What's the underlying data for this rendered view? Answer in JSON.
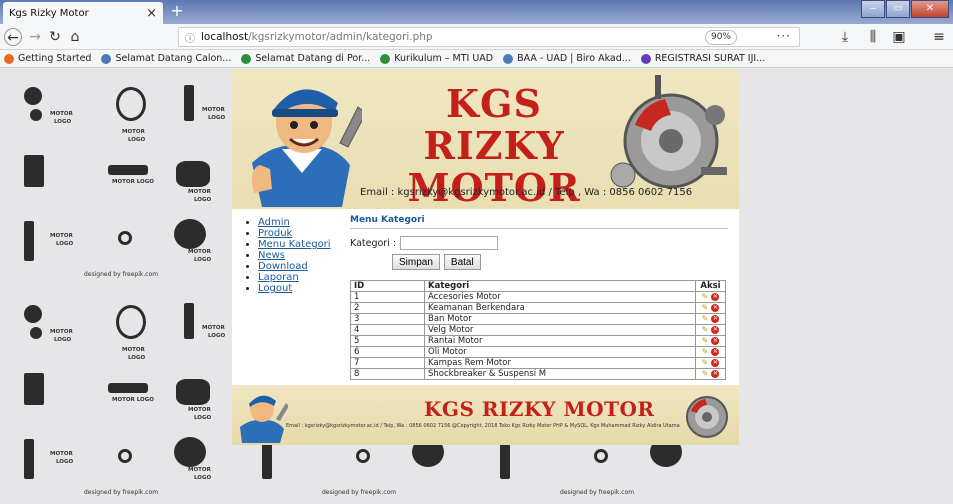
{
  "browser": {
    "tab_title": "Kgs Rizky Motor",
    "tab_close": "×",
    "new_tab": "+",
    "url_host": "localhost",
    "url_path": "/kgsrizkymotor/admin/kategori.php",
    "zoom": "90%",
    "more": "···",
    "bookmarks": [
      {
        "label": "Getting Started",
        "color": "#e66b1e"
      },
      {
        "label": "Selamat Datang Calon...",
        "color": "#4a7db8"
      },
      {
        "label": "Selamat Datang di Por...",
        "color": "#2c8f3a"
      },
      {
        "label": "Kurikulum – MTI UAD",
        "color": "#2c8f3a"
      },
      {
        "label": "BAA - UAD | Biro Akad...",
        "color": "#4a7db8"
      },
      {
        "label": "REGISTRASI SURAT IJI...",
        "color": "#6a3db8"
      }
    ]
  },
  "header": {
    "title_line1": "KGS RIZKY",
    "title_line2": "MOTOR",
    "contact": "Email : kgsrizky@kgsrizkymotor.ac.id / Telp , Wa : 0856 0602 7156"
  },
  "sidebar": {
    "items": [
      "Admin",
      "Produk",
      "Menu Kategori",
      "News",
      "Download",
      "Laporan",
      "Logout"
    ]
  },
  "main": {
    "section_title": "Menu Kategori",
    "field_label": "Kategori :",
    "field_value": "",
    "save_label": "Simpan",
    "cancel_label": "Batal",
    "table": {
      "headers": [
        "ID",
        "Kategori",
        "Aksi"
      ],
      "rows": [
        {
          "id": "1",
          "kategori": "Accesories Motor"
        },
        {
          "id": "2",
          "kategori": "Keamanan Berkendara"
        },
        {
          "id": "3",
          "kategori": "Ban Motor"
        },
        {
          "id": "4",
          "kategori": "Velg Motor"
        },
        {
          "id": "5",
          "kategori": "Rantai Motor"
        },
        {
          "id": "6",
          "kategori": "Oli Motor"
        },
        {
          "id": "7",
          "kategori": "Kampas Rem Motor"
        },
        {
          "id": "8",
          "kategori": "Shockbreaker & Suspensi M"
        }
      ]
    }
  },
  "footer": {
    "title": "KGS RIZKY MOTOR",
    "text": "Email : kgsrizky@kgsrizkymotor.ac.id / Telp, Wa : 0856 0602 7156   @Copyright, 2018 Toko Kgs Rizky Motor PHP & MySQL, Kgs Muhammad Rizky Aldira Utama"
  },
  "background": {
    "motor_label": "MOTOR",
    "logo_label": "LOGO",
    "motor_logo_label": "MOTOR LOGO",
    "credit": "designed by freepik.com"
  },
  "colors": {
    "brand_red": "#c4201a",
    "link_blue": "#1a5a9a",
    "header_bg": "#f0e7c3"
  }
}
